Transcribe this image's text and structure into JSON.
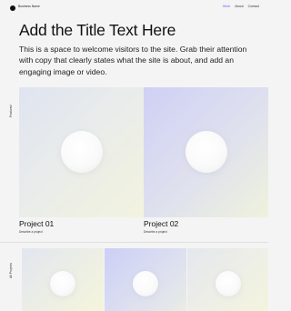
{
  "header": {
    "brand": "Business Name",
    "nav": [
      {
        "label": "Work",
        "active": true
      },
      {
        "label": "About",
        "active": false
      },
      {
        "label": "Contact",
        "active": false
      }
    ]
  },
  "hero": {
    "title": "Add the Title Text Here",
    "text": "This is a space to welcome visitors to the site. Grab their attention with copy that clearly states what the site is about, and add an engaging image or video."
  },
  "featured": {
    "label": "Featured",
    "projects": [
      {
        "title": "Project 01",
        "description": "Describe a project"
      },
      {
        "title": "Project 02",
        "description": "Describe a project"
      }
    ]
  },
  "all_projects": {
    "label": "All Projects"
  },
  "colors": {
    "accent": "#6b62ff",
    "background": "#f4f4f4"
  }
}
